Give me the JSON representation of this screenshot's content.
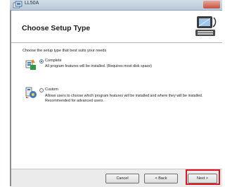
{
  "window": {
    "title": "LL50A",
    "icon": "installer-icon",
    "close_icon": "close-icon"
  },
  "header": {
    "title": "Choose Setup Type",
    "icon": "computer-setup-icon"
  },
  "content": {
    "prompt": "Choose the setup type that best suits your needs",
    "options": [
      {
        "label": "Complete",
        "description": "All program features will be installed. (Requires most disk space)",
        "selected": true,
        "icon": "complete-setup-icon"
      },
      {
        "label": "Custom",
        "description": "Allows users to choose which program features will be installed and where they will be installed. Recommended for advanced users.",
        "selected": false,
        "icon": "custom-setup-icon"
      }
    ]
  },
  "footer": {
    "cancel_label": "Cancel",
    "back_label": "< Back",
    "next_label": "Next >"
  },
  "colors": {
    "highlight": "#e0141e",
    "radio_dot": "#1f5fb5"
  }
}
